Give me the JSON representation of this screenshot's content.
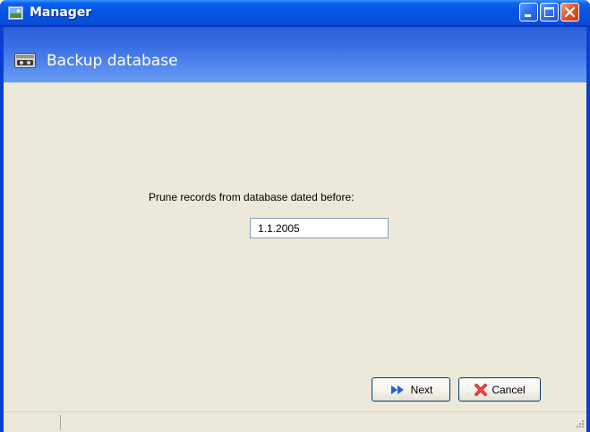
{
  "window": {
    "title": "Manager",
    "title_color": "#ffffff",
    "titlebar_color": "#0752e0"
  },
  "title_buttons": {
    "minimize_icon": "minimize-icon",
    "maximize_icon": "maximize-icon",
    "close_icon": "close-icon"
  },
  "header": {
    "title": "Backup database",
    "icon": "tape-drive-icon"
  },
  "content": {
    "prompt": "Prune records from database dated before:",
    "date_value": "1.1.2005",
    "background": "#ece9d8"
  },
  "buttons": {
    "next_label": "Next",
    "next_icon": "double-arrow-right-icon",
    "cancel_label": "Cancel",
    "cancel_icon": "red-x-icon"
  }
}
